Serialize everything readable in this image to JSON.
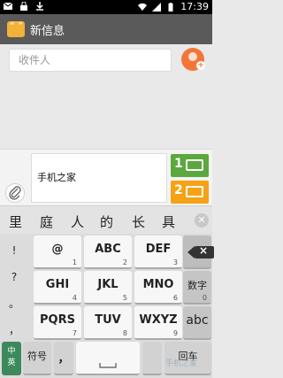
{
  "status_bar": {
    "time": "17:39"
  },
  "header": {
    "title": "新信息"
  },
  "recipient": {
    "placeholder": "收件人"
  },
  "compose": {
    "text": "手机之家",
    "sim1_label": "1",
    "sim2_label": "2"
  },
  "candidates": [
    "里",
    "庭",
    "人",
    "的",
    "长",
    "具"
  ],
  "keyboard": {
    "side_symbols": [
      "!",
      "?",
      "。",
      "，"
    ],
    "row1": [
      {
        "label": "@",
        "sub": "1"
      },
      {
        "label": "ABC",
        "sub": "2"
      },
      {
        "label": "DEF",
        "sub": "3"
      }
    ],
    "row2": [
      {
        "label": "GHI",
        "sub": "4"
      },
      {
        "label": "JKL",
        "sub": "5"
      },
      {
        "label": "MNO",
        "sub": "6"
      }
    ],
    "row3": [
      {
        "label": "PQRS",
        "sub": "7"
      },
      {
        "label": "TUV",
        "sub": "8"
      },
      {
        "label": "WXYZ",
        "sub": "9"
      }
    ],
    "numbers_label": "数字",
    "numbers_sub": "0",
    "abc_label": "abc",
    "lang_top": "中",
    "lang_bottom": "英",
    "symbol_label": "符号",
    "comma_label": "，",
    "space_sub": "",
    "enter_label": "回车"
  },
  "watermark": "手机之家"
}
